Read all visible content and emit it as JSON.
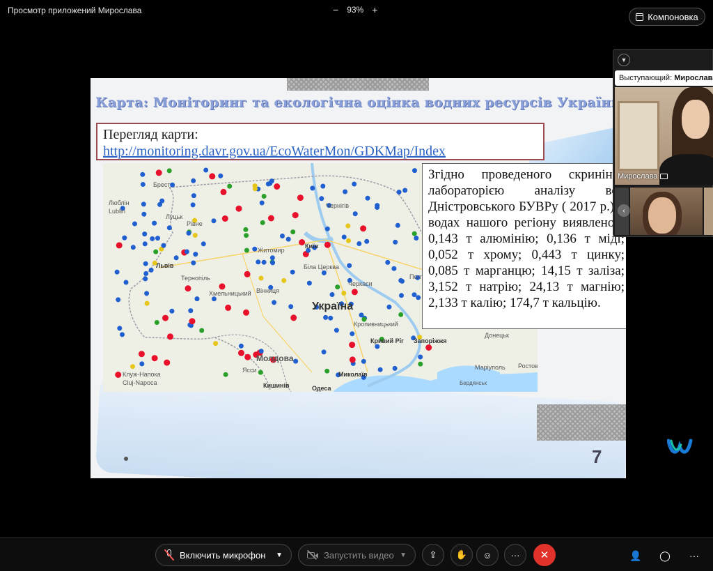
{
  "window": {
    "title": "Просмотр приложений Мирослава",
    "zoom": "93%",
    "zoom_out_icon": "−",
    "zoom_in_icon": "+",
    "layout_button": "Компоновка"
  },
  "slide": {
    "title": "Карта: Моніторинг та екологічна оцінка водних ресурсів України",
    "link_label": "Перегляд карти:",
    "link_url": "http://monitoring.davr.gov.ua/EcoWaterMon/GDKMap/Index",
    "text": "Згідно проведеного скринінгу лабораторією аналізу вод Дністровського БУВРу ( 2017 р.) у водах нашого регіону виявлено : 0,143 т алюмінію; 0,136 т міді; 0,052 т хрому; 0,443 т цинку; 0,085 т марганцю; 14,15 т заліза; 3,152 т натрію; 24,13 т магнію; 2,133 т калію; 174,7 т кальцію.",
    "page_number": "7",
    "map": {
      "country_label": "Україна",
      "cities": [
        "Брест",
        "Люблін",
        "Lublin",
        "Львів",
        "Тернопіль",
        "Хмельницький",
        "Вінниця",
        "Житомир",
        "Київ",
        "Біла Церква",
        "Черкаси",
        "Кропивницький",
        "Кривий Ріг",
        "Запоріжжя",
        "Донецьк",
        "Маріуполь",
        "Бердянськ",
        "Ростов",
        "Миколаїв",
        "Одеса",
        "Кишинів",
        "Ясси",
        "Молдова",
        "Клуж-Напока",
        "Cluj-Napoca",
        "Чернігів",
        "Полтава",
        "Рівне",
        "Луцьк"
      ]
    }
  },
  "speaker_panel": {
    "label_prefix": "Выступающий:",
    "label_name": "Мирослава",
    "participant_name": "Мирослава"
  },
  "controls": {
    "mic_label": "Включить микрофон",
    "video_label": "Запустить видео",
    "more_label": "···",
    "end_icon": "✕"
  },
  "colors": {
    "end_call": "#e0322b",
    "map_blue_dot": "#1f5fd0",
    "map_red_dot": "#e8102a",
    "map_green_dot": "#2aa02a",
    "map_yellow_dot": "#e6c619",
    "link": "#2a63c4"
  }
}
